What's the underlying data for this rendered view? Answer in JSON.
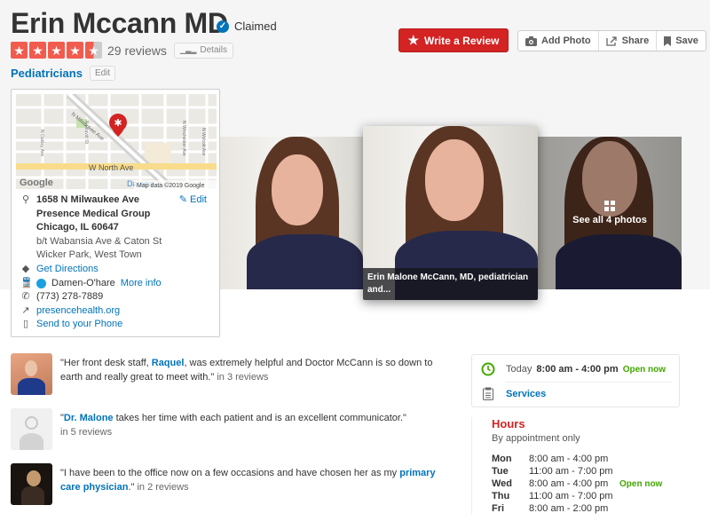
{
  "business": {
    "name": "Erin Mccann MD",
    "claimed_label": "Claimed",
    "rating": 4.5,
    "rating_max": 5,
    "reviews_label": "29 reviews",
    "details_label": "Details",
    "category": "Pediatricians",
    "edit_label": "Edit"
  },
  "actions": {
    "write_review": "Write a Review",
    "add_photo": "Add Photo",
    "share": "Share",
    "save": "Save"
  },
  "map": {
    "streets": [
      "N Milwaukee Ave",
      "N Leavitt St",
      "N Oakley Ave",
      "N Winchester Ave",
      "N Wolcott Ave",
      "W North Ave"
    ],
    "station_label": "Damen",
    "logo": "Google",
    "attribution": "Map data ©2019 Google"
  },
  "location": {
    "address_line1": "1658 N Milwaukee Ave",
    "address_line2": "Presence Medical Group",
    "address_line3": "Chicago, IL 60647",
    "cross_streets": "b/t Wabansia Ave & Caton St",
    "neighborhood": "Wicker Park, West Town",
    "edit_label": "Edit",
    "directions_label": "Get Directions",
    "transit_station": "Damen-O'hare",
    "transit_more": "More info",
    "transit_color": "#1ba1e2",
    "phone": "(773) 278-7889",
    "website": "presencehealth.org",
    "send_to_phone": "Send to your Phone"
  },
  "photos": {
    "featured_caption": "Erin Malone McCann, MD, pediatrician and...",
    "see_all_label": "See all 4 photos"
  },
  "tips": [
    {
      "pre": "\"Her front desk staff, ",
      "link": "Raquel",
      "post": ", was extremely helpful and Doctor McCann is so down to earth and really great to meet with.\"",
      "count": " in 3 reviews"
    },
    {
      "pre": "\"",
      "link": "Dr. Malone",
      "post": " takes her time with each patient and is an excellent communicator.\"",
      "count": "in 5 reviews"
    },
    {
      "pre": "\"I have been to the office now on a few occasions and have chosen her as my ",
      "link": "primary care physician",
      "post": ".\"",
      "count": " in 2 reviews"
    }
  ],
  "today": {
    "label": "Today",
    "hours": "8:00 am - 4:00 pm",
    "status": "Open now",
    "services_label": "Services"
  },
  "hours": {
    "title": "Hours",
    "subtitle": "By appointment only",
    "rows": [
      {
        "day": "Mon",
        "time": "8:00 am - 4:00 pm",
        "status": ""
      },
      {
        "day": "Tue",
        "time": "11:00 am - 7:00 pm",
        "status": ""
      },
      {
        "day": "Wed",
        "time": "8:00 am - 4:00 pm",
        "status": "Open now"
      },
      {
        "day": "Thu",
        "time": "11:00 am - 7:00 pm",
        "status": ""
      },
      {
        "day": "Fri",
        "time": "8:00 am - 2:00 pm",
        "status": ""
      }
    ]
  },
  "colors": {
    "brand_red": "#d32323",
    "star_red": "#f15c4f",
    "link_blue": "#0073bb",
    "open_green": "#41a700"
  }
}
